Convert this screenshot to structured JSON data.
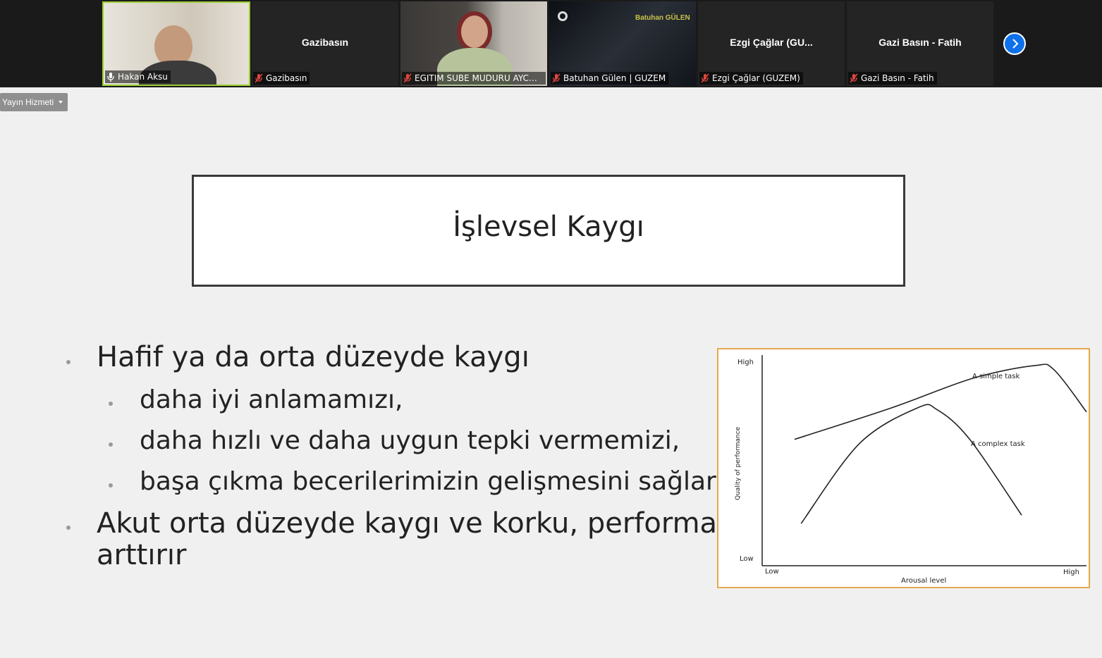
{
  "participants": [
    {
      "name": "Hakan Aksu",
      "center": "",
      "muted": false,
      "video": true
    },
    {
      "name": "Gazibasın",
      "center": "Gazibasın",
      "muted": true,
      "video": false
    },
    {
      "name": "EGITIM SUBE MUDURU AYCA ...",
      "center": "",
      "muted": true,
      "video": true
    },
    {
      "name": "Batuhan Gülen | GUZEM",
      "center": "",
      "muted": true,
      "video": true
    },
    {
      "name": "Ezgi Çağlar (GUZEM)",
      "center": "Ezgi Çağlar (GU...",
      "muted": true,
      "video": false
    },
    {
      "name": "Gazi Basın - Fatih",
      "center": "Gazi Basın - Fatih",
      "muted": true,
      "video": false
    }
  ],
  "tile3_overlay_text": "Batuhan GÜLEN",
  "stream_button": "Yayın Hizmeti",
  "slide": {
    "title": "İşlevsel Kaygı",
    "bullets": [
      {
        "level": 1,
        "text": "Hafif ya da orta düzeyde kaygı"
      },
      {
        "level": 2,
        "text": "daha iyi anlamamızı,"
      },
      {
        "level": 2,
        "text": "daha hızlı ve daha uygun tepki vermemizi,"
      },
      {
        "level": 2,
        "text": "başa çıkma becerilerimizin gelişmesini sağlar"
      },
      {
        "level": 1,
        "text": "Akut orta düzeyde kaygı ve korku, performansı"
      },
      {
        "level": 1,
        "text": "arttırır"
      }
    ]
  },
  "chart_data": {
    "type": "line",
    "xlabel": "Arousal level",
    "ylabel": "Quality of performance",
    "x_ticks": [
      "Low",
      "High"
    ],
    "y_ticks": [
      "Low",
      "High"
    ],
    "series": [
      {
        "name": "A simple task",
        "x": [
          0.1,
          0.4,
          0.65,
          0.84,
          0.9,
          1.0
        ],
        "y": [
          0.6,
          0.75,
          0.89,
          0.95,
          0.93,
          0.73
        ]
      },
      {
        "name": "A complex task",
        "x": [
          0.12,
          0.3,
          0.48,
          0.54,
          0.64,
          0.8
        ],
        "y": [
          0.2,
          0.58,
          0.75,
          0.74,
          0.6,
          0.24
        ]
      }
    ],
    "xlim": [
      0,
      1
    ],
    "ylim": [
      0,
      1
    ],
    "colors": {
      "line": "#222222",
      "border": "#e3a94b"
    }
  }
}
